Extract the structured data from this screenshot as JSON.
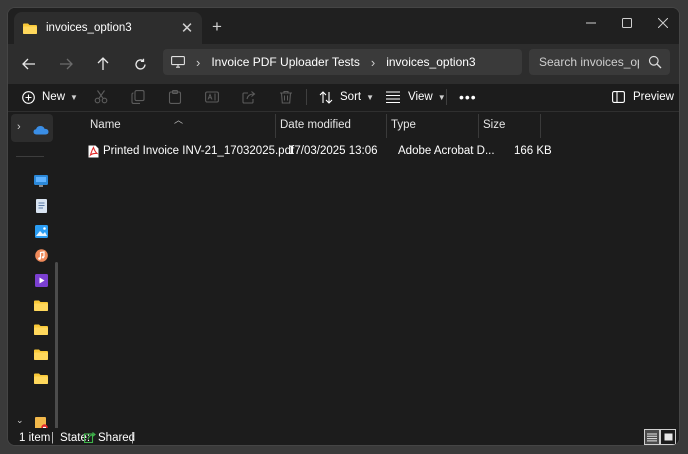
{
  "colors": {
    "window_bg": "#1c1c1c",
    "toolbar_bg": "#2d2d2d",
    "accent_blue": "#3a8ee6",
    "folder_yellow": "#f8c837",
    "pdf_red": "#e02b2b",
    "shared_green": "#3fb64b"
  },
  "tab": {
    "title": "invoices_option3",
    "close_icon": "close-icon",
    "new_tab_icon": "plus-icon"
  },
  "address": {
    "breadcrumbs": [
      "Invoice PDF Uploader Tests",
      "invoices_option3"
    ],
    "root_icon": "monitor-icon"
  },
  "search": {
    "placeholder": "Search invoices_opti"
  },
  "commands": {
    "new_label": "New",
    "sort_label": "Sort",
    "view_label": "View",
    "preview_label": "Preview"
  },
  "columns": {
    "name": "Name",
    "date": "Date modified",
    "type": "Type",
    "size": "Size"
  },
  "files": [
    {
      "name": "Printed Invoice INV-21_17032025.pdf",
      "date": "17/03/2025 13:06",
      "type": "Adobe Acrobat D...",
      "size": "166 KB",
      "icon": "pdf-file-icon"
    }
  ],
  "status": {
    "count": "1 item",
    "state_label": "State:",
    "state_value": "Shared",
    "sep": "|"
  }
}
